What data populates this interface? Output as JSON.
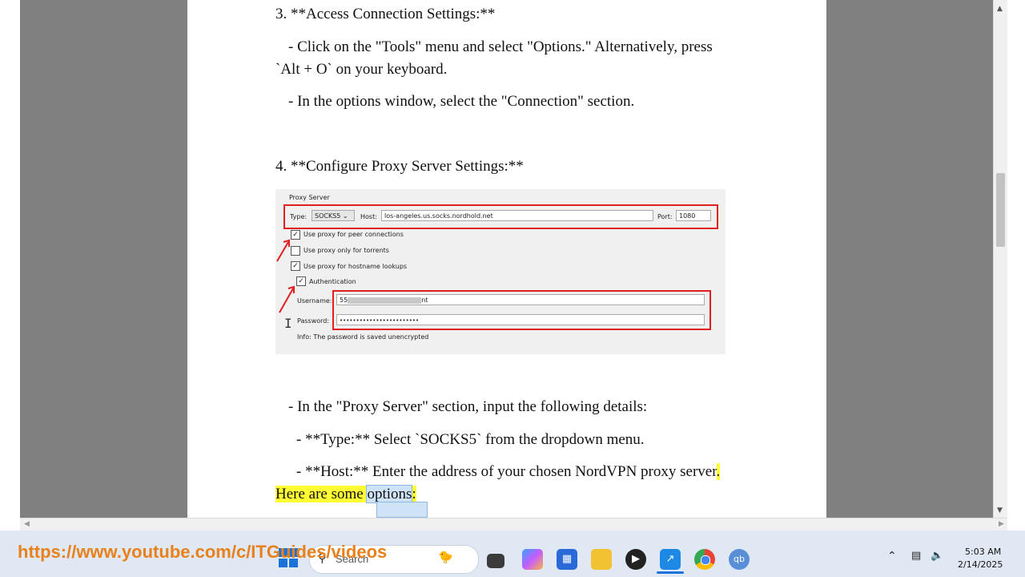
{
  "document": {
    "step3_heading": "3. **Access Connection Settings:**",
    "step3_line1": "- Click on the \"Tools\" menu and select \"Options.\" Alternatively, press",
    "step3_line2": "`Alt + O` on your keyboard.",
    "step3_line3": "- In the options window, select the \"Connection\" section.",
    "step4_heading": "4. **Configure Proxy Server Settings:**",
    "proxy_line": "- In the \"Proxy Server\" section, input the following details:",
    "type_line": "- **Type:** Select `SOCKS5` from the dropdown menu.",
    "host_line": "- **Host:** Enter the address of your chosen NordVPN proxy server",
    "host_line_end": ".",
    "options_prefix": "Here are some ",
    "options_word": "options",
    "options_suffix": ":"
  },
  "screenshot": {
    "group_title": "Proxy Server",
    "type_label": "Type:",
    "type_value": "SOCKS5",
    "host_label": "Host:",
    "host_value": "los-angeles.us.socks.nordhold.net",
    "port_label": "Port:",
    "port_value": "1080",
    "cb_peer": "Use proxy for peer connections",
    "cb_torrents": "Use proxy only for torrents",
    "cb_hostname": "Use proxy for hostname lookups",
    "cb_auth": "Authentication",
    "username_label": "Username:",
    "username_start": "55",
    "username_end": "nt",
    "password_label": "Password:",
    "password_value": "••••••••••••••••••••••••",
    "info": "Info: The password is saved unencrypted"
  },
  "overlay": {
    "url": "https://www.youtube.com/c/ITGuides/videos"
  },
  "taskbar": {
    "search_placeholder": "Search",
    "time": "5:03 AM",
    "date": "2/14/2025",
    "icons": [
      "windows-start-icon",
      "search-icon",
      "task-view-icon",
      "copilot-icon",
      "store-icon",
      "file-explorer-icon",
      "media-player-icon",
      "whiteboard-icon",
      "chrome-icon",
      "qbittorrent-icon"
    ]
  },
  "colors": {
    "highlight": "#ffff33",
    "red_box": "#e02020",
    "url": "#e8801c",
    "taskbar": "#dfe8f3"
  }
}
